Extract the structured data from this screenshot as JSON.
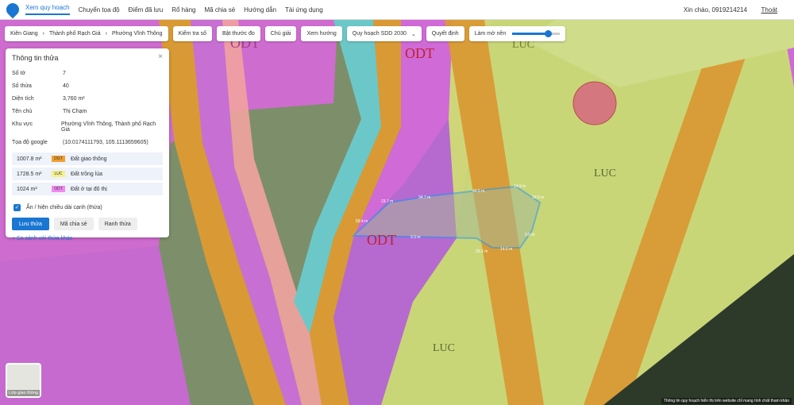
{
  "nav": {
    "items": [
      "Xem quy hoạch",
      "Chuyển tọa độ",
      "Điểm đã lưu",
      "Rổ hàng",
      "Mã chia sẻ",
      "Hướng dẫn",
      "Tài ứng dụng"
    ],
    "greeting": "Xin chào, 0919214214",
    "logout": "Thoát"
  },
  "toolbar": {
    "breadcrumb": [
      "Kiên Giang",
      "Thành phố Rạch Giá",
      "Phường Vĩnh Thông"
    ],
    "check_size": "Kiểm tra số",
    "measure": "Bật thước đo",
    "legend": "Chú giải",
    "view_direction": "Xem hướng",
    "plan_select": "Quy hoạch SDD 2030",
    "decision": "Quyết định",
    "blur_label": "Làm mờ nền",
    "blur_level": 0.75
  },
  "panel": {
    "title": "Thông tin thửa",
    "fields": [
      {
        "k": "Số tờ",
        "v": "7"
      },
      {
        "k": "Số thửa",
        "v": "40"
      },
      {
        "k": "Diện tích",
        "v": "3,760 m²"
      },
      {
        "k": "Tên chủ",
        "v": "Thị Chạm"
      },
      {
        "k": "Khu vực",
        "v": "Phường Vĩnh Thông, Thành phố Rạch Giá"
      },
      {
        "k": "Tọa độ google",
        "v": "(10.0174111793, 105.1113659605)"
      }
    ],
    "land_use": [
      {
        "area": "1007.8 m²",
        "code": "DGT",
        "name": "Đất giao thông",
        "color": "#f0a030"
      },
      {
        "area": "1728.5 m²",
        "code": "LUC",
        "name": "Đất trồng lúa",
        "color": "#f5f08a"
      },
      {
        "area": "1024 m²",
        "code": "ODT",
        "name": "Đất ở tại đô thị",
        "color": "#f08af0"
      }
    ],
    "checkbox_label": "Ẩn / hiện chiều dài cạnh (thửa)",
    "btn_save": "Lưu thửa",
    "btn_share": "Mã chia sẻ",
    "btn_boundary": "Ranh thửa",
    "compare_link": "+ So sánh với thửa khác"
  },
  "map": {
    "labels": [
      "ODT",
      "ODT",
      "LUC",
      "LUC",
      "LUC",
      "ODT"
    ],
    "edges": [
      "23.7 m",
      "34.7 m",
      "44.5 m",
      "14.9 m",
      "19.5 m",
      "9.5 m",
      "14.6 m",
      "29.2 m",
      "9.3 m",
      "59.4 m"
    ],
    "layer_button": "Lớp giao thông",
    "attribution": "Thông tin quy hoạch hiển thị trên website chỉ mang tính chất tham khảo"
  }
}
